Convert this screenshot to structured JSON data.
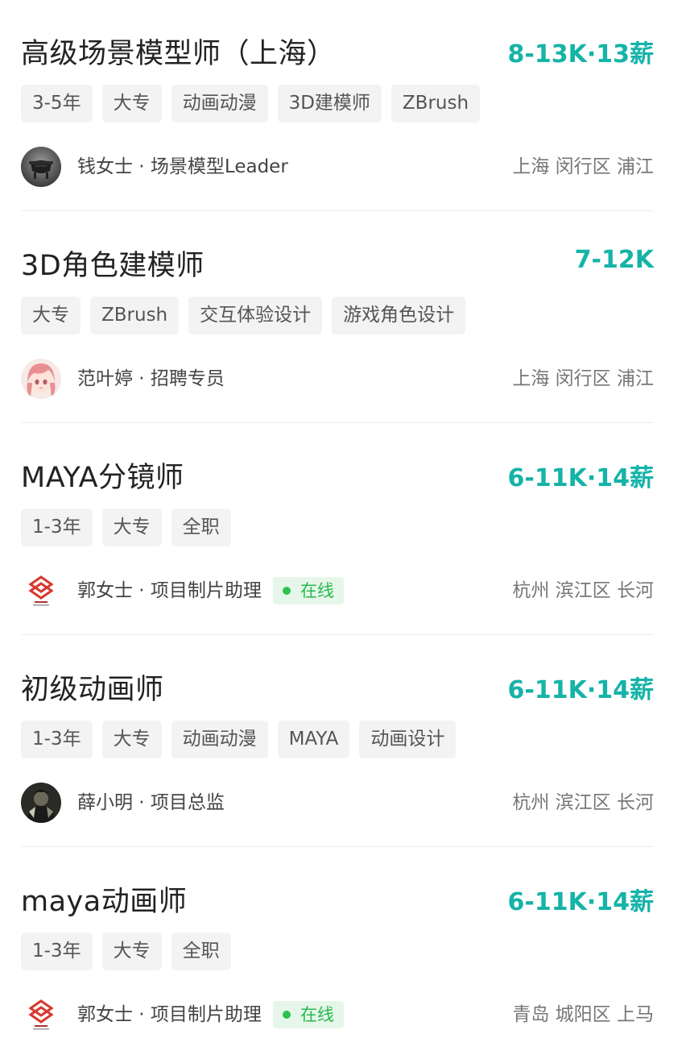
{
  "colors": {
    "salary": "#15b3a8",
    "online_text": "#28b94d",
    "online_bg": "#e6f7ea",
    "tag_bg": "#f3f3f3"
  },
  "jobs": [
    {
      "title": "高级场景模型师（上海）",
      "salary": "8-13K·13薪",
      "tags": [
        "3-5年",
        "大专",
        "动画动漫",
        "3D建模师",
        "ZBrush"
      ],
      "recruiter": "钱女士 · 场景模型Leader",
      "avatar": "bronze-vessel-avatar",
      "online": "",
      "location": "上海 闵行区 浦江"
    },
    {
      "title": "3D角色建模师",
      "salary": "7-12K",
      "tags": [
        "大专",
        "ZBrush",
        "交互体验设计",
        "游戏角色设计"
      ],
      "recruiter": "范叶婷 · 招聘专员",
      "avatar": "anime-girl-avatar",
      "online": "",
      "location": "上海 闵行区 浦江"
    },
    {
      "title": "MAYA分镜师",
      "salary": "6-11K·14薪",
      "tags": [
        "1-3年",
        "大专",
        "全职"
      ],
      "recruiter": "郭女士 · 项目制片助理",
      "avatar": "company-logo-avatar",
      "online": "在线",
      "location": "杭州 滨江区 长河"
    },
    {
      "title": "初级动画师",
      "salary": "6-11K·14薪",
      "tags": [
        "1-3年",
        "大专",
        "动画动漫",
        "MAYA",
        "动画设计"
      ],
      "recruiter": "薛小明 · 项目总监",
      "avatar": "dark-character-avatar",
      "online": "",
      "location": "杭州 滨江区 长河"
    },
    {
      "title": "maya动画师",
      "salary": "6-11K·14薪",
      "tags": [
        "1-3年",
        "大专",
        "全职"
      ],
      "recruiter": "郭女士 · 项目制片助理",
      "avatar": "company-logo-avatar",
      "online": "在线",
      "location": "青岛 城阳区 上马"
    }
  ]
}
